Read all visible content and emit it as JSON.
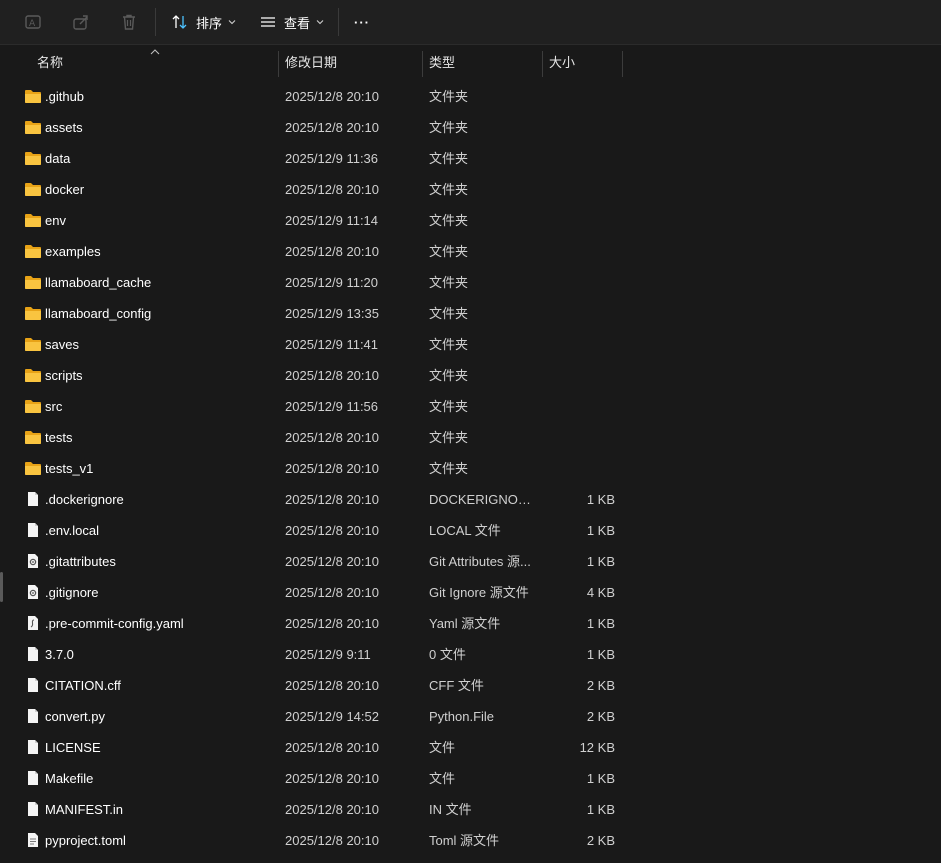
{
  "toolbar": {
    "sort_label": "排序",
    "view_label": "查看",
    "more_label": "···"
  },
  "columns": {
    "name": "名称",
    "date": "修改日期",
    "type": "类型",
    "size": "大小"
  },
  "colors": {
    "background": "#191919",
    "folder": "#F9C440",
    "accent": "#4CC2FF"
  },
  "files": [
    {
      "name": ".github",
      "date": "2025/12/8 20:10",
      "type": "文件夹",
      "size": "",
      "icon": "folder-icon"
    },
    {
      "name": "assets",
      "date": "2025/12/8 20:10",
      "type": "文件夹",
      "size": "",
      "icon": "folder-icon"
    },
    {
      "name": "data",
      "date": "2025/12/9 11:36",
      "type": "文件夹",
      "size": "",
      "icon": "folder-icon"
    },
    {
      "name": "docker",
      "date": "2025/12/8 20:10",
      "type": "文件夹",
      "size": "",
      "icon": "folder-icon"
    },
    {
      "name": "env",
      "date": "2025/12/9 11:14",
      "type": "文件夹",
      "size": "",
      "icon": "folder-icon"
    },
    {
      "name": "examples",
      "date": "2025/12/8 20:10",
      "type": "文件夹",
      "size": "",
      "icon": "folder-icon"
    },
    {
      "name": "llamaboard_cache",
      "date": "2025/12/9 11:20",
      "type": "文件夹",
      "size": "",
      "icon": "folder-icon"
    },
    {
      "name": "llamaboard_config",
      "date": "2025/12/9 13:35",
      "type": "文件夹",
      "size": "",
      "icon": "folder-icon"
    },
    {
      "name": "saves",
      "date": "2025/12/9 11:41",
      "type": "文件夹",
      "size": "",
      "icon": "folder-icon"
    },
    {
      "name": "scripts",
      "date": "2025/12/8 20:10",
      "type": "文件夹",
      "size": "",
      "icon": "folder-icon"
    },
    {
      "name": "src",
      "date": "2025/12/9 11:56",
      "type": "文件夹",
      "size": "",
      "icon": "folder-icon"
    },
    {
      "name": "tests",
      "date": "2025/12/8 20:10",
      "type": "文件夹",
      "size": "",
      "icon": "folder-icon"
    },
    {
      "name": "tests_v1",
      "date": "2025/12/8 20:10",
      "type": "文件夹",
      "size": "",
      "icon": "folder-icon"
    },
    {
      "name": ".dockerignore",
      "date": "2025/12/8 20:10",
      "type": "DOCKERIGNOR...",
      "size": "1 KB",
      "icon": "file-icon"
    },
    {
      "name": ".env.local",
      "date": "2025/12/8 20:10",
      "type": "LOCAL 文件",
      "size": "1 KB",
      "icon": "file-icon"
    },
    {
      "name": ".gitattributes",
      "date": "2025/12/8 20:10",
      "type": "Git Attributes 源...",
      "size": "1 KB",
      "icon": "gear-file-icon"
    },
    {
      "name": ".gitignore",
      "date": "2025/12/8 20:10",
      "type": "Git Ignore 源文件",
      "size": "4 KB",
      "icon": "gear-file-icon"
    },
    {
      "name": ".pre-commit-config.yaml",
      "date": "2025/12/8 20:10",
      "type": "Yaml 源文件",
      "size": "1 KB",
      "icon": "script-file-icon"
    },
    {
      "name": "3.7.0",
      "date": "2025/12/9 9:11",
      "type": "0 文件",
      "size": "1 KB",
      "icon": "file-icon"
    },
    {
      "name": "CITATION.cff",
      "date": "2025/12/8 20:10",
      "type": "CFF 文件",
      "size": "2 KB",
      "icon": "file-icon"
    },
    {
      "name": "convert.py",
      "date": "2025/12/9 14:52",
      "type": "Python.File",
      "size": "2 KB",
      "icon": "file-icon"
    },
    {
      "name": "LICENSE",
      "date": "2025/12/8 20:10",
      "type": "文件",
      "size": "12 KB",
      "icon": "file-icon"
    },
    {
      "name": "Makefile",
      "date": "2025/12/8 20:10",
      "type": "文件",
      "size": "1 KB",
      "icon": "file-icon"
    },
    {
      "name": "MANIFEST.in",
      "date": "2025/12/8 20:10",
      "type": "IN 文件",
      "size": "1 KB",
      "icon": "file-icon"
    },
    {
      "name": "pyproject.toml",
      "date": "2025/12/8 20:10",
      "type": "Toml 源文件",
      "size": "2 KB",
      "icon": "text-file-icon"
    }
  ]
}
